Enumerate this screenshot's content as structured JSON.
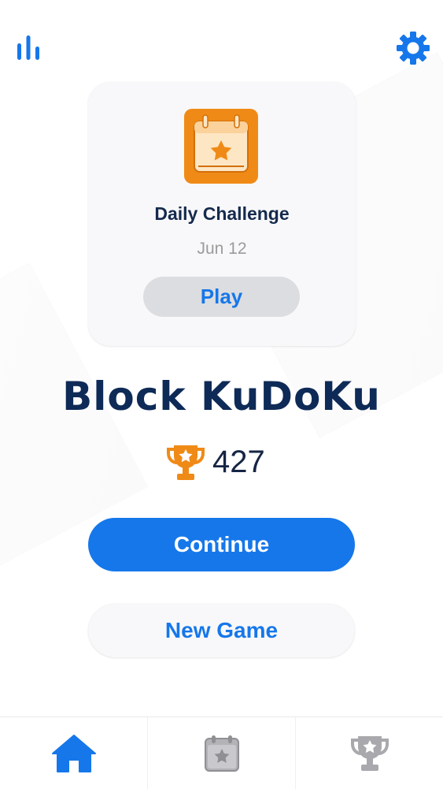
{
  "app": {
    "title": "Block KuDoKu",
    "score": "427"
  },
  "toolbar": {
    "stats_icon": "bar-chart-icon",
    "settings_icon": "gear-icon"
  },
  "daily_challenge": {
    "title": "Daily Challenge",
    "date": "Jun 12",
    "play_label": "Play",
    "icon": "calendar-star-icon"
  },
  "buttons": {
    "continue_label": "Continue",
    "new_game_label": "New Game"
  },
  "tabs": [
    {
      "icon": "home-icon",
      "active": true
    },
    {
      "icon": "calendar-star-icon",
      "active": false
    },
    {
      "icon": "trophy-icon",
      "active": false
    }
  ],
  "colors": {
    "primary_blue": "#1677ea",
    "title_navy": "#0e2a57",
    "accent_orange": "#f08a17",
    "inactive_gray": "#a9a9ad"
  }
}
